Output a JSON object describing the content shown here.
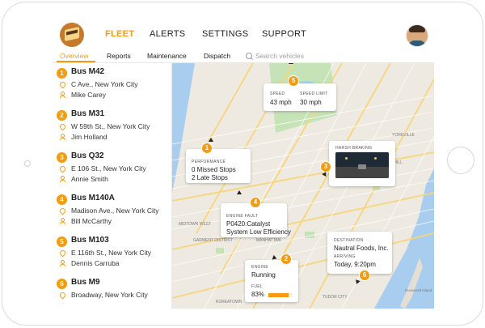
{
  "header": {
    "nav": [
      "FLEET",
      "ALERTS",
      "SETTINGS",
      "SUPPORT"
    ],
    "active_nav": "FLEET",
    "subnav": [
      "Overview",
      "Reports",
      "Maintenance",
      "Dispatch"
    ],
    "active_subnav": "Overview",
    "search_placeholder": "Search vehicles"
  },
  "buses": [
    {
      "number": "1",
      "name": "Bus M42",
      "location": "C Ave., New York City",
      "driver": "Mike Carey"
    },
    {
      "number": "2",
      "name": "Bus M31",
      "location": "W 59th St., New York City",
      "driver": "Jim Holland"
    },
    {
      "number": "3",
      "name": "Bus Q32",
      "location": "E 106 St., New York City",
      "driver": "Annie Smith"
    },
    {
      "number": "4",
      "name": "Bus M140A",
      "location": "Madison Ave., New York City",
      "driver": "Bill McCarthy"
    },
    {
      "number": "5",
      "name": "Bus M103",
      "location": "E 116th St., New York City",
      "driver": "Dennis Carruba"
    },
    {
      "number": "6",
      "name": "Bus M9",
      "location": "Broadway, New York City",
      "driver": ""
    }
  ],
  "map_cards": {
    "speed": {
      "speed_label": "SPEED",
      "speed_value": "43 mph",
      "limit_label": "SPEED LIMIT",
      "limit_value": "30 mph",
      "badge": "5"
    },
    "performance": {
      "label": "PERFORMANCE",
      "line1": "0 Missed Stops",
      "line2": "2 Late Stops",
      "badge": "1"
    },
    "harsh": {
      "label": "HARSH BRAKING",
      "badge": "3"
    },
    "engine_fault": {
      "label": "ENGINE FAULT",
      "line1": "P0420:Catalyst",
      "line2": "System Low Efficiency",
      "badge": "4"
    },
    "engine": {
      "label": "ENGINE",
      "value": "Running",
      "fuel_label": "FUEL",
      "fuel_value": "83%",
      "fuel_fraction": 0.83,
      "badge": "2"
    },
    "destination": {
      "label": "DESTINATION",
      "value": "Nautral Foods, Inc.",
      "arriving_label": "ARRIVING",
      "arriving_value": "Today, 9:20pm",
      "badge": "6"
    }
  },
  "map_labels": {
    "midtown_west": "MIDTOWN WEST",
    "garment_district": "GARMENT DISTRICT",
    "manhattan": "MANHATTAN",
    "lenox_hill": "LENOX HILL",
    "tudor_city": "TUDOR CITY",
    "yorkville": "YORKVILLE",
    "roosevelt_island": "Roosevelt Island",
    "koreatown": "KOREATOWN"
  },
  "colors": {
    "accent": "#f39c12",
    "map_land": "#eeeae1",
    "map_water": "#a8cdee",
    "map_park": "#c5e3b6"
  }
}
